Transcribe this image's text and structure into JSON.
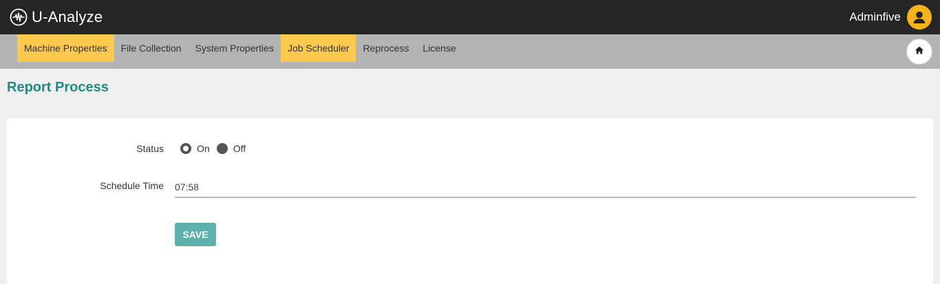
{
  "app": {
    "name": "U-Analyze",
    "user_name": "Adminfive",
    "brand_icon": "waveform-circle-icon",
    "avatar_icon": "user-circle-icon"
  },
  "nav": {
    "items": [
      {
        "label": "Machine Properties",
        "active": true
      },
      {
        "label": "File Collection",
        "active": false
      },
      {
        "label": "System Properties",
        "active": false
      },
      {
        "label": "Job Scheduler",
        "active": true
      },
      {
        "label": "Reprocess",
        "active": false
      },
      {
        "label": "License",
        "active": false
      }
    ],
    "home_icon": "home-icon"
  },
  "page": {
    "title": "Report Process"
  },
  "form": {
    "status_label": "Status",
    "status_options": [
      {
        "label": "On",
        "selected": true
      },
      {
        "label": "Off",
        "selected": false
      }
    ],
    "schedule_label": "Schedule Time",
    "schedule_value": "07:58",
    "save_label": "SAVE"
  },
  "colors": {
    "topbar": "#252525",
    "navbar": "#b3b3b3",
    "active_tab": "#fcc94f",
    "title": "#1f8c84",
    "save_button": "#5fafab",
    "avatar": "#f4b41a"
  }
}
